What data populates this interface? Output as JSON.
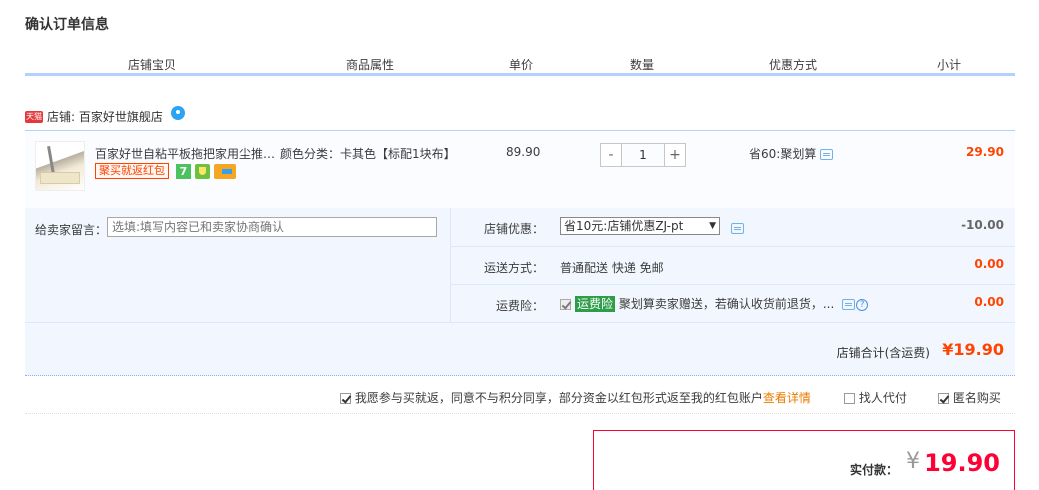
{
  "page_title": "确认订单信息",
  "columns": [
    "店铺宝贝",
    "商品属性",
    "单价",
    "数量",
    "优惠方式",
    "小计"
  ],
  "shop": {
    "badge": "天猫",
    "label": "店铺: 百家好世旗舰店"
  },
  "item": {
    "name": "百家好世自粘平板拖把家用尘推…",
    "attr": "颜色分类：卡其色【标配1块布】",
    "redbag_tag": "聚买就返红包",
    "badge_7": "7",
    "price": "89.90",
    "qty_minus": "-",
    "qty_value": "1",
    "qty_plus": "+",
    "discount": "省60:聚划算",
    "subtotal": "29.90"
  },
  "options": {
    "memo_label": "给卖家留言：",
    "memo_placeholder": "选填:填写内容已和卖家协商确认",
    "shop_coupon_label": "店铺优惠：",
    "shop_coupon_value": "省10元:店铺优惠ZJ-pt",
    "shop_coupon_amount": "-10.00",
    "shipping_label": "运送方式：",
    "shipping_value": "普通配送 快递 免邮",
    "shipping_amount": "0.00",
    "insurance_label": "运费险：",
    "insurance_tag": "运费险",
    "insurance_text": "聚划算卖家赠送，若确认收货前退货，...",
    "insurance_amount": "0.00",
    "help_glyph": "?",
    "shop_total_label": "店铺合计(含运费)",
    "shop_total_amount": "¥19.90"
  },
  "agreement": {
    "rebate_text": "我愿参与买就返，同意不与积分同享，部分资金以红包形式返至我的红包账户",
    "rebate_link": "查看详情",
    "proxy_pay": "找人代付",
    "anonymous": "匿名购买"
  },
  "payment": {
    "label": "实付款：",
    "yen": "¥",
    "amount": "19.90"
  },
  "colors": {
    "accent_red": "#ff0036",
    "price_orange": "#ff4400",
    "header_line": "#b2d1ff",
    "options_bg": "#f2f7ff"
  }
}
